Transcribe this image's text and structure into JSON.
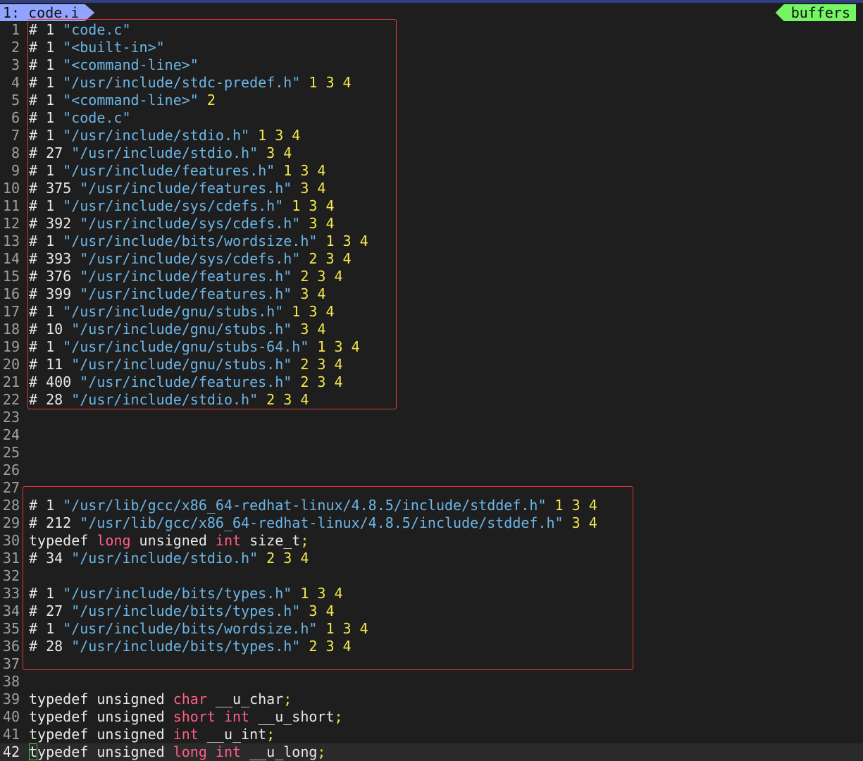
{
  "tabline": {
    "active_tab": "1: code.i",
    "buffers_label": "buffers"
  },
  "colors": {
    "background": "#1e1e1e",
    "string": "#6cb6e8",
    "number": "#f5e94a",
    "type_keyword": "#ff5f87",
    "line_number": "#a0a0a0",
    "highlight_box": "#e33838",
    "active_tab": "#8fa3ff",
    "buffers_tag": "#74f562"
  },
  "lines": [
    {
      "n": "1",
      "tokens": [
        {
          "t": "# 1 ",
          "c": "plain"
        },
        {
          "t": "\"code.c\"",
          "c": "str"
        }
      ]
    },
    {
      "n": "2",
      "tokens": [
        {
          "t": "# 1 ",
          "c": "plain"
        },
        {
          "t": "\"<built-in>\"",
          "c": "str"
        }
      ]
    },
    {
      "n": "3",
      "tokens": [
        {
          "t": "# 1 ",
          "c": "plain"
        },
        {
          "t": "\"<command-line>\"",
          "c": "str"
        }
      ]
    },
    {
      "n": "4",
      "tokens": [
        {
          "t": "# 1 ",
          "c": "plain"
        },
        {
          "t": "\"/usr/include/stdc-predef.h\"",
          "c": "str"
        },
        {
          "t": " 1 3 4",
          "c": "num"
        }
      ]
    },
    {
      "n": "5",
      "tokens": [
        {
          "t": "# 1 ",
          "c": "plain"
        },
        {
          "t": "\"<command-line>\"",
          "c": "str"
        },
        {
          "t": " 2",
          "c": "num"
        }
      ]
    },
    {
      "n": "6",
      "tokens": [
        {
          "t": "# 1 ",
          "c": "plain"
        },
        {
          "t": "\"code.c\"",
          "c": "str"
        }
      ]
    },
    {
      "n": "7",
      "tokens": [
        {
          "t": "# 1 ",
          "c": "plain"
        },
        {
          "t": "\"/usr/include/stdio.h\"",
          "c": "str"
        },
        {
          "t": " 1 3 4",
          "c": "num"
        }
      ]
    },
    {
      "n": "8",
      "tokens": [
        {
          "t": "# 27 ",
          "c": "plain"
        },
        {
          "t": "\"/usr/include/stdio.h\"",
          "c": "str"
        },
        {
          "t": " 3 4",
          "c": "num"
        }
      ]
    },
    {
      "n": "9",
      "tokens": [
        {
          "t": "# 1 ",
          "c": "plain"
        },
        {
          "t": "\"/usr/include/features.h\"",
          "c": "str"
        },
        {
          "t": " 1 3 4",
          "c": "num"
        }
      ]
    },
    {
      "n": "10",
      "tokens": [
        {
          "t": "# 375 ",
          "c": "plain"
        },
        {
          "t": "\"/usr/include/features.h\"",
          "c": "str"
        },
        {
          "t": " 3 4",
          "c": "num"
        }
      ]
    },
    {
      "n": "11",
      "tokens": [
        {
          "t": "# 1 ",
          "c": "plain"
        },
        {
          "t": "\"/usr/include/sys/cdefs.h\"",
          "c": "str"
        },
        {
          "t": " 1 3 4",
          "c": "num"
        }
      ]
    },
    {
      "n": "12",
      "tokens": [
        {
          "t": "# 392 ",
          "c": "plain"
        },
        {
          "t": "\"/usr/include/sys/cdefs.h\"",
          "c": "str"
        },
        {
          "t": " 3 4",
          "c": "num"
        }
      ]
    },
    {
      "n": "13",
      "tokens": [
        {
          "t": "# 1 ",
          "c": "plain"
        },
        {
          "t": "\"/usr/include/bits/wordsize.h\"",
          "c": "str"
        },
        {
          "t": " 1 3 4",
          "c": "num"
        }
      ]
    },
    {
      "n": "14",
      "tokens": [
        {
          "t": "# 393 ",
          "c": "plain"
        },
        {
          "t": "\"/usr/include/sys/cdefs.h\"",
          "c": "str"
        },
        {
          "t": " 2 3 4",
          "c": "num"
        }
      ]
    },
    {
      "n": "15",
      "tokens": [
        {
          "t": "# 376 ",
          "c": "plain"
        },
        {
          "t": "\"/usr/include/features.h\"",
          "c": "str"
        },
        {
          "t": " 2 3 4",
          "c": "num"
        }
      ]
    },
    {
      "n": "16",
      "tokens": [
        {
          "t": "# 399 ",
          "c": "plain"
        },
        {
          "t": "\"/usr/include/features.h\"",
          "c": "str"
        },
        {
          "t": " 3 4",
          "c": "num"
        }
      ]
    },
    {
      "n": "17",
      "tokens": [
        {
          "t": "# 1 ",
          "c": "plain"
        },
        {
          "t": "\"/usr/include/gnu/stubs.h\"",
          "c": "str"
        },
        {
          "t": " 1 3 4",
          "c": "num"
        }
      ]
    },
    {
      "n": "18",
      "tokens": [
        {
          "t": "# 10 ",
          "c": "plain"
        },
        {
          "t": "\"/usr/include/gnu/stubs.h\"",
          "c": "str"
        },
        {
          "t": " 3 4",
          "c": "num"
        }
      ]
    },
    {
      "n": "19",
      "tokens": [
        {
          "t": "# 1 ",
          "c": "plain"
        },
        {
          "t": "\"/usr/include/gnu/stubs-64.h\"",
          "c": "str"
        },
        {
          "t": " 1 3 4",
          "c": "num"
        }
      ]
    },
    {
      "n": "20",
      "tokens": [
        {
          "t": "# 11 ",
          "c": "plain"
        },
        {
          "t": "\"/usr/include/gnu/stubs.h\"",
          "c": "str"
        },
        {
          "t": " 2 3 4",
          "c": "num"
        }
      ]
    },
    {
      "n": "21",
      "tokens": [
        {
          "t": "# 400 ",
          "c": "plain"
        },
        {
          "t": "\"/usr/include/features.h\"",
          "c": "str"
        },
        {
          "t": " 2 3 4",
          "c": "num"
        }
      ]
    },
    {
      "n": "22",
      "tokens": [
        {
          "t": "# 28 ",
          "c": "plain"
        },
        {
          "t": "\"/usr/include/stdio.h\"",
          "c": "str"
        },
        {
          "t": " 2 3 4",
          "c": "num"
        }
      ]
    },
    {
      "n": "23",
      "tokens": []
    },
    {
      "n": "24",
      "tokens": []
    },
    {
      "n": "25",
      "tokens": []
    },
    {
      "n": "26",
      "tokens": []
    },
    {
      "n": "27",
      "tokens": []
    },
    {
      "n": "28",
      "tokens": [
        {
          "t": "# 1 ",
          "c": "plain"
        },
        {
          "t": "\"/usr/lib/gcc/x86_64-redhat-linux/4.8.5/include/stddef.h\"",
          "c": "str"
        },
        {
          "t": " 1 3 4",
          "c": "num"
        }
      ]
    },
    {
      "n": "29",
      "tokens": [
        {
          "t": "# 212 ",
          "c": "plain"
        },
        {
          "t": "\"/usr/lib/gcc/x86_64-redhat-linux/4.8.5/include/stddef.h\"",
          "c": "str"
        },
        {
          "t": " 3 4",
          "c": "num"
        }
      ]
    },
    {
      "n": "30",
      "tokens": [
        {
          "t": "typedef ",
          "c": "plain"
        },
        {
          "t": "long",
          "c": "type"
        },
        {
          "t": " unsigned ",
          "c": "plain"
        },
        {
          "t": "int",
          "c": "type"
        },
        {
          "t": " size_t",
          "c": "plain"
        },
        {
          "t": ";",
          "c": "punct"
        }
      ]
    },
    {
      "n": "31",
      "tokens": [
        {
          "t": "# 34 ",
          "c": "plain"
        },
        {
          "t": "\"/usr/include/stdio.h\"",
          "c": "str"
        },
        {
          "t": " 2 3 4",
          "c": "num"
        }
      ]
    },
    {
      "n": "32",
      "tokens": []
    },
    {
      "n": "33",
      "tokens": [
        {
          "t": "# 1 ",
          "c": "plain"
        },
        {
          "t": "\"/usr/include/bits/types.h\"",
          "c": "str"
        },
        {
          "t": " 1 3 4",
          "c": "num"
        }
      ]
    },
    {
      "n": "34",
      "tokens": [
        {
          "t": "# 27 ",
          "c": "plain"
        },
        {
          "t": "\"/usr/include/bits/types.h\"",
          "c": "str"
        },
        {
          "t": " 3 4",
          "c": "num"
        }
      ]
    },
    {
      "n": "35",
      "tokens": [
        {
          "t": "# 1 ",
          "c": "plain"
        },
        {
          "t": "\"/usr/include/bits/wordsize.h\"",
          "c": "str"
        },
        {
          "t": " 1 3 4",
          "c": "num"
        }
      ]
    },
    {
      "n": "36",
      "tokens": [
        {
          "t": "# 28 ",
          "c": "plain"
        },
        {
          "t": "\"/usr/include/bits/types.h\"",
          "c": "str"
        },
        {
          "t": " 2 3 4",
          "c": "num"
        }
      ]
    },
    {
      "n": "37",
      "tokens": []
    },
    {
      "n": "38",
      "tokens": []
    },
    {
      "n": "39",
      "tokens": [
        {
          "t": "typedef unsigned ",
          "c": "plain"
        },
        {
          "t": "char",
          "c": "type"
        },
        {
          "t": " __u_char",
          "c": "plain"
        },
        {
          "t": ";",
          "c": "punct"
        }
      ]
    },
    {
      "n": "40",
      "tokens": [
        {
          "t": "typedef unsigned ",
          "c": "plain"
        },
        {
          "t": "short",
          "c": "type"
        },
        {
          "t": " ",
          "c": "plain"
        },
        {
          "t": "int",
          "c": "type"
        },
        {
          "t": " __u_short",
          "c": "plain"
        },
        {
          "t": ";",
          "c": "punct"
        }
      ]
    },
    {
      "n": "41",
      "tokens": [
        {
          "t": "typedef unsigned ",
          "c": "plain"
        },
        {
          "t": "int",
          "c": "type"
        },
        {
          "t": " __u_int",
          "c": "plain"
        },
        {
          "t": ";",
          "c": "punct"
        }
      ]
    },
    {
      "n": "42",
      "cursor": true,
      "tokens": [
        {
          "t": "t",
          "c": "plain",
          "cursor": true
        },
        {
          "t": "ypedef unsigned ",
          "c": "plain"
        },
        {
          "t": "long",
          "c": "type"
        },
        {
          "t": " ",
          "c": "plain"
        },
        {
          "t": "int",
          "c": "type"
        },
        {
          "t": " __u_long",
          "c": "plain"
        },
        {
          "t": ";",
          "c": "punct"
        }
      ]
    }
  ]
}
